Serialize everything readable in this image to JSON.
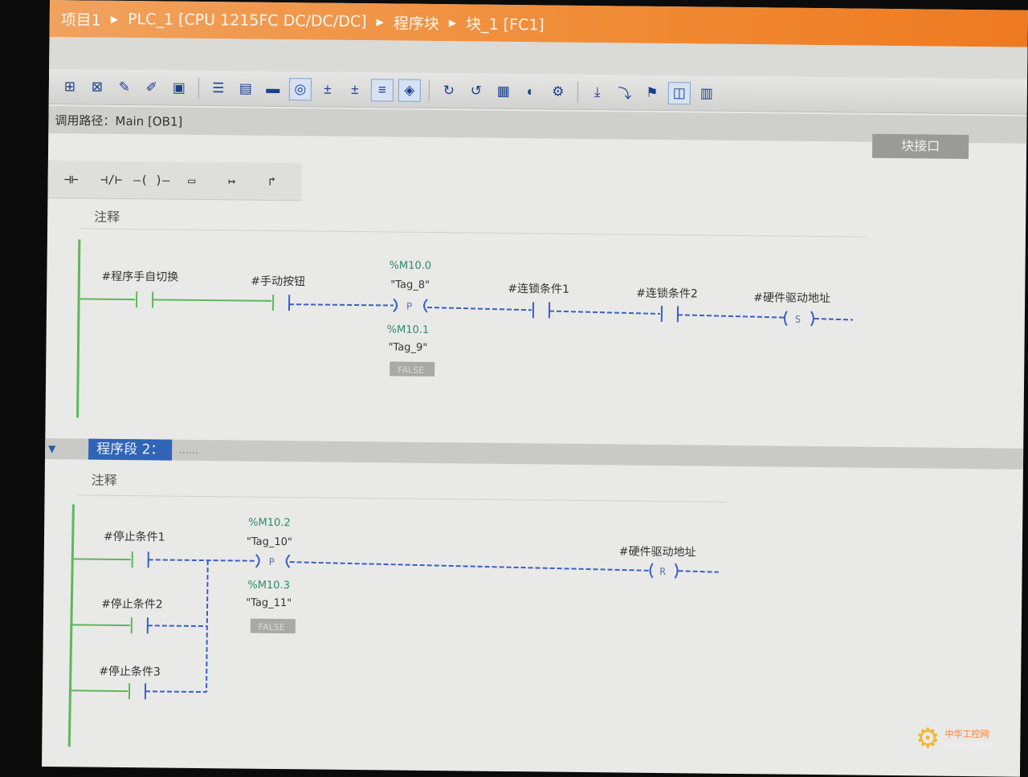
{
  "breadcrumb": {
    "items": [
      "项目1",
      "PLC_1 [CPU 1215FC DC/DC/DC]",
      "程序块",
      "块_1 [FC1]"
    ]
  },
  "toolbar": {
    "icons": [
      "insert-network-icon",
      "delete-network-icon",
      "insert-row-icon",
      "delete-row-icon",
      "open-all-icon",
      "abs-rel-icon",
      "show-favorites-icon",
      "display-icon",
      "comment-icon",
      "networks-expand-icon",
      "networks-collapse-icon",
      "toggle-comments-icon",
      "online-view-icon",
      "go-online-icon",
      "monitor-icon",
      "modify-icon",
      "breakpoint-icon",
      "step-icon",
      "step-over-icon",
      "call-environment-icon",
      "show-values-icon",
      "block-status-icon"
    ]
  },
  "call_path": "调用路径：Main [OB1]",
  "block_interface": "块接口",
  "ladder_toolbar": [
    "⊣⊢",
    "⊣/⊢",
    "–( )–",
    "▭",
    "↦",
    "↱"
  ],
  "network1": {
    "comment": "注释",
    "contacts": [
      "#程序手自切换",
      "#手动按钮",
      "#连锁条件1",
      "#连锁条件2"
    ],
    "pedge": {
      "addr_top": "%M10.0",
      "tag_top": "\"Tag_8\"",
      "symbol": "P",
      "addr_bottom": "%M10.1",
      "tag_bottom": "\"Tag_9\"",
      "status": "FALSE"
    },
    "coil": {
      "label": "#硬件驱动地址",
      "symbol": "S"
    }
  },
  "network2": {
    "title": "程序段 2：",
    "dots": "......",
    "comment": "注释",
    "contacts": [
      "#停止条件1",
      "#停止条件2",
      "#停止条件3"
    ],
    "pedge": {
      "addr_top": "%M10.2",
      "tag_top": "\"Tag_10\"",
      "symbol": "P",
      "addr_bottom": "%M10.3",
      "tag_bottom": "\"Tag_11\"",
      "status": "FALSE"
    },
    "coil": {
      "label": "#硬件驱动地址",
      "symbol": "R"
    }
  },
  "watermark": {
    "line1": "中华工控网",
    "line2": "gkong.com"
  },
  "colors": {
    "title_bar": "#f08a34",
    "powered": "#5cb85c",
    "unpowered": "#3a5fc8",
    "selected": "#2f64b7"
  }
}
